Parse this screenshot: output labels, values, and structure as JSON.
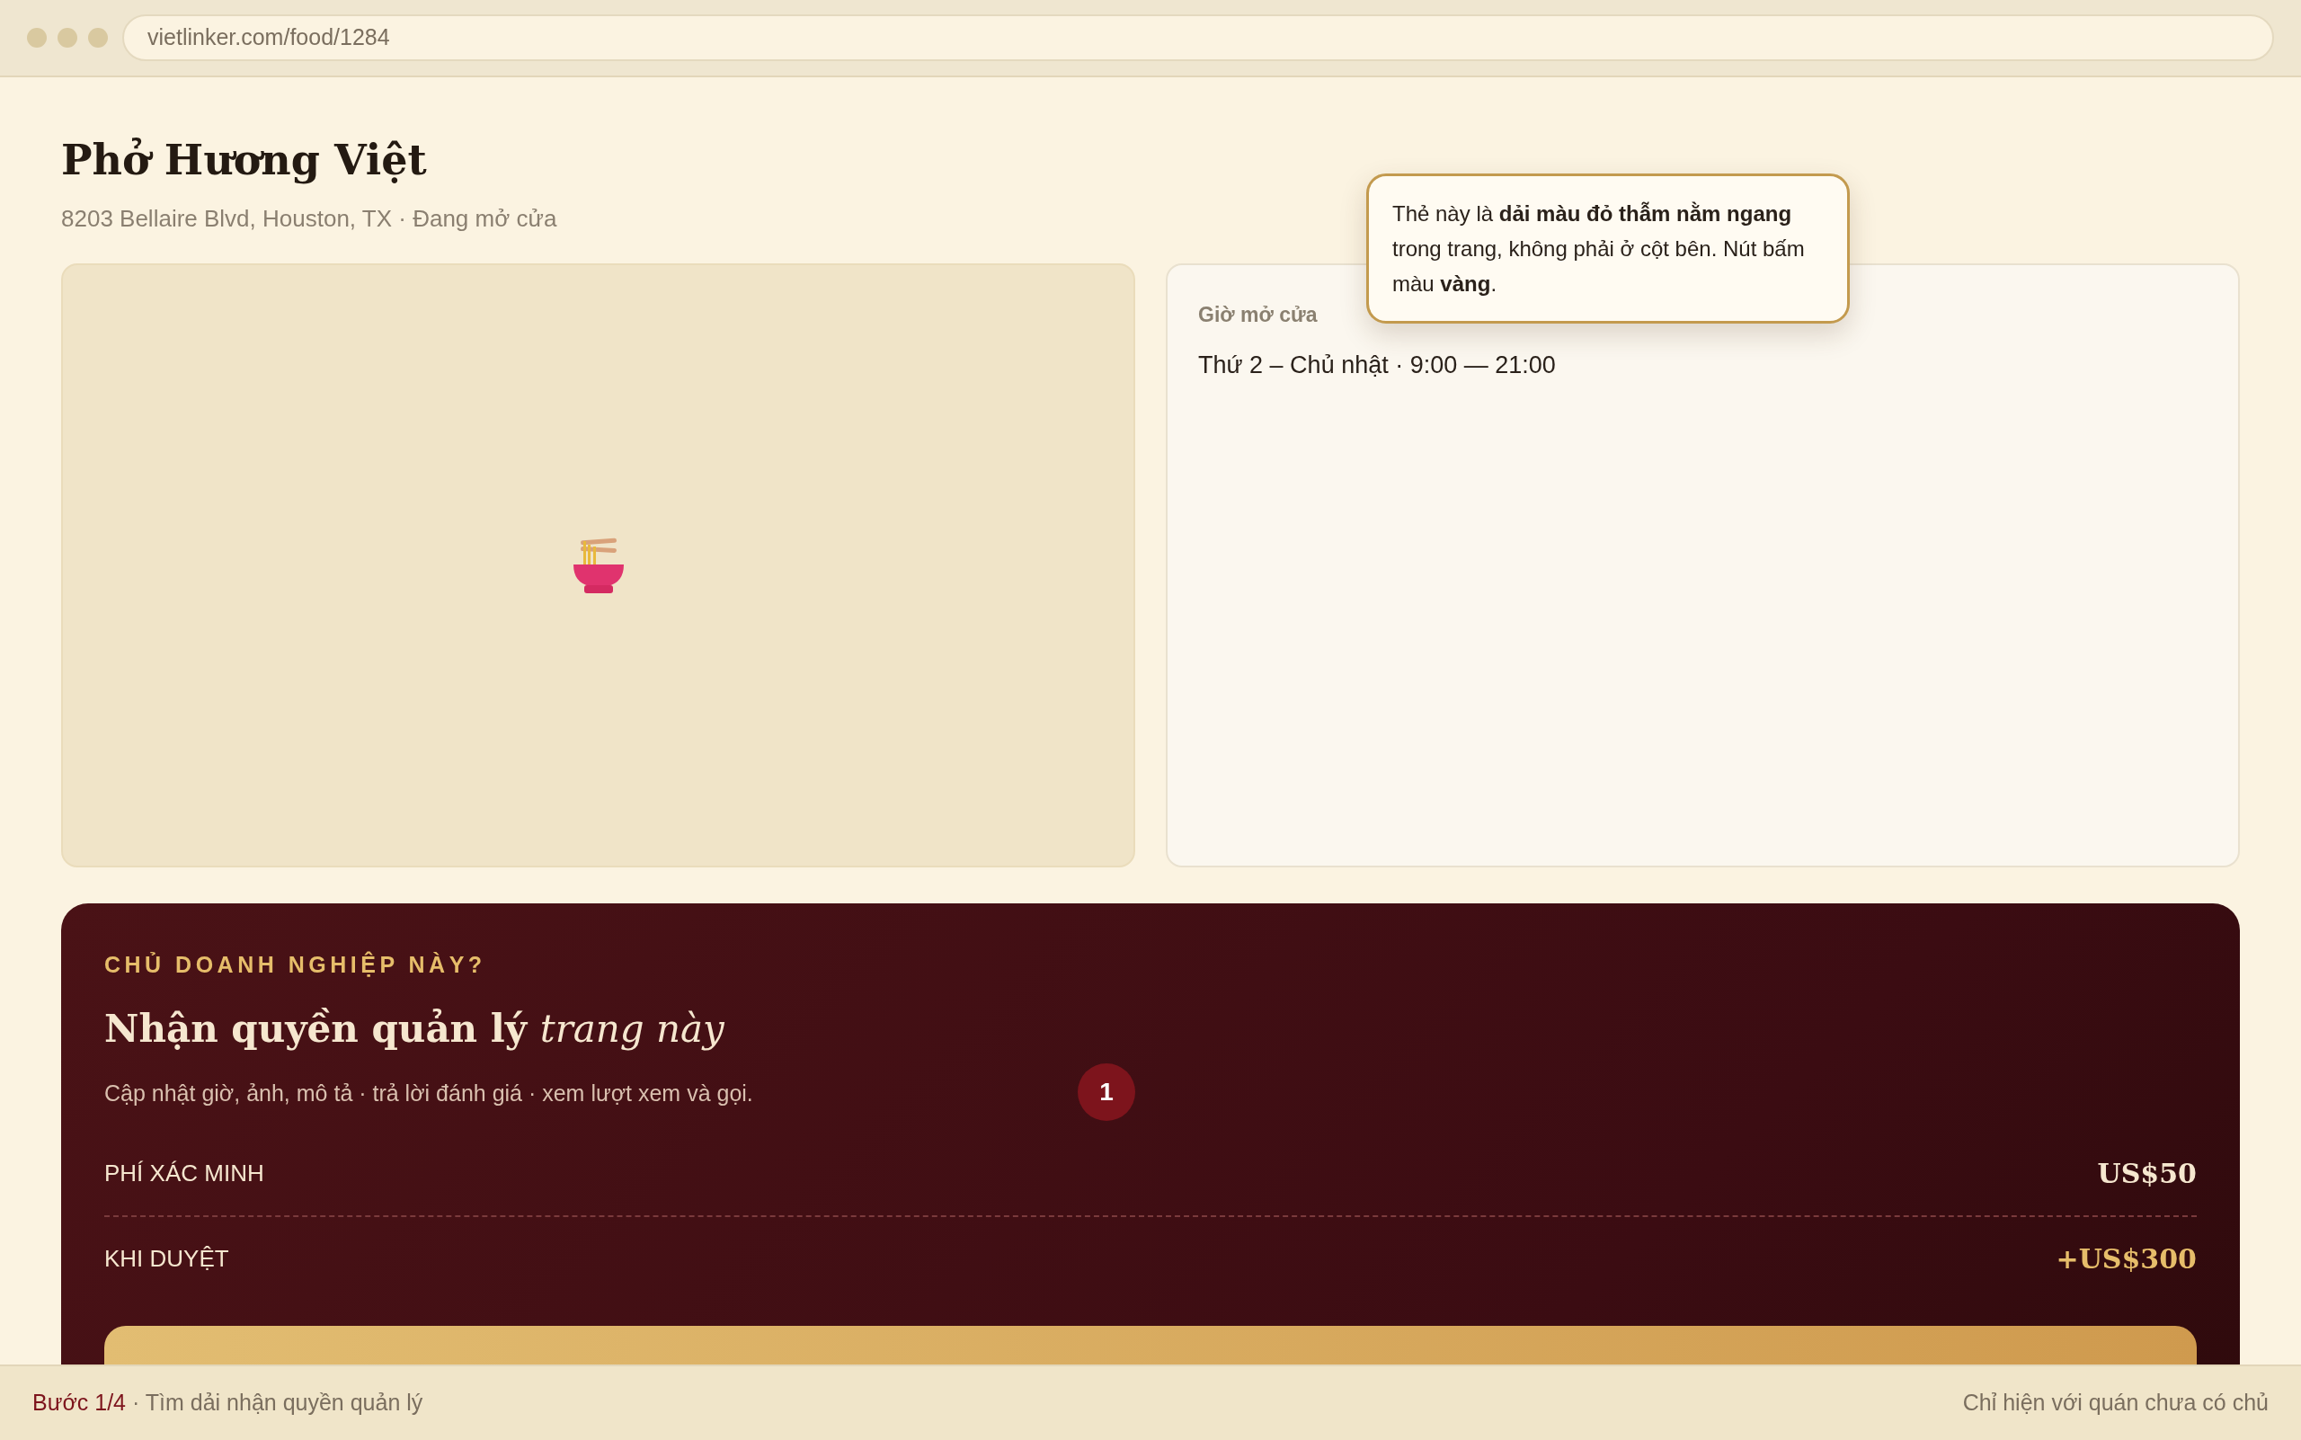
{
  "browser": {
    "url": "vietlinker.com/food/1284"
  },
  "page": {
    "title": "Phở Hương Việt",
    "subtitle": "8203 Bellaire Blvd, Houston, TX · Đang mở cửa"
  },
  "hours_card": {
    "label": "Giờ mở cửa",
    "text": "Thứ 2 – Chủ nhật · 9:00 — 21:00"
  },
  "tooltip": {
    "text": "Thẻ này là **dải màu đỏ thẫm nằm ngang** trong trang, không phải ở cột bên. Nút bấm màu **vàng**."
  },
  "banner": {
    "eyebrow": "CHỦ DOANH NGHIỆP NÀY?",
    "heading": "Nhận quyền quản lý *trang này*",
    "description": "Cập nhật giờ, ảnh, mô tả · trả lời đánh giá · xem lượt xem và gọi.",
    "step_marker": "1",
    "rows": [
      {
        "label": "PHÍ XÁC MINH",
        "amount": "US$50",
        "kind": "base"
      },
      {
        "label": "KHI DUYỆT",
        "amount": "+US$300",
        "kind": "bonus"
      }
    ]
  },
  "footer": {
    "step": "**Bước 1/4** · Tìm dải nhận quyền quản lý",
    "note": "Chỉ hiện với quán chưa có chủ"
  }
}
